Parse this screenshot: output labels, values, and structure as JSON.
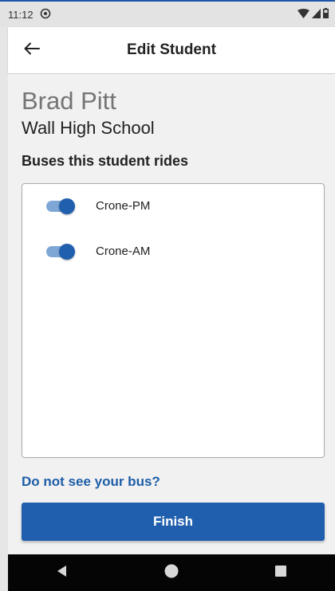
{
  "status_bar": {
    "time": "11:12",
    "icons": [
      "sync-icon",
      "wifi-icon",
      "signal-icon",
      "battery-icon"
    ]
  },
  "app_bar": {
    "title": "Edit Student",
    "back_icon": "arrow-left-icon"
  },
  "student": {
    "name": "Brad Pitt",
    "school": "Wall High School"
  },
  "buses_section": {
    "title": "Buses this student rides",
    "buses": [
      {
        "label": "Crone-PM",
        "enabled": true
      },
      {
        "label": "Crone-AM",
        "enabled": true
      }
    ]
  },
  "help_link": "Do not see your bus?",
  "finish_label": "Finish",
  "nav_bar": {
    "buttons": [
      "back-triangle-icon",
      "home-circle-icon",
      "recents-square-icon"
    ]
  },
  "colors": {
    "primary": "#1f5fae",
    "toggle_track": "#7fa7d6",
    "link": "#1e5ea8",
    "name_gray": "#757575"
  }
}
